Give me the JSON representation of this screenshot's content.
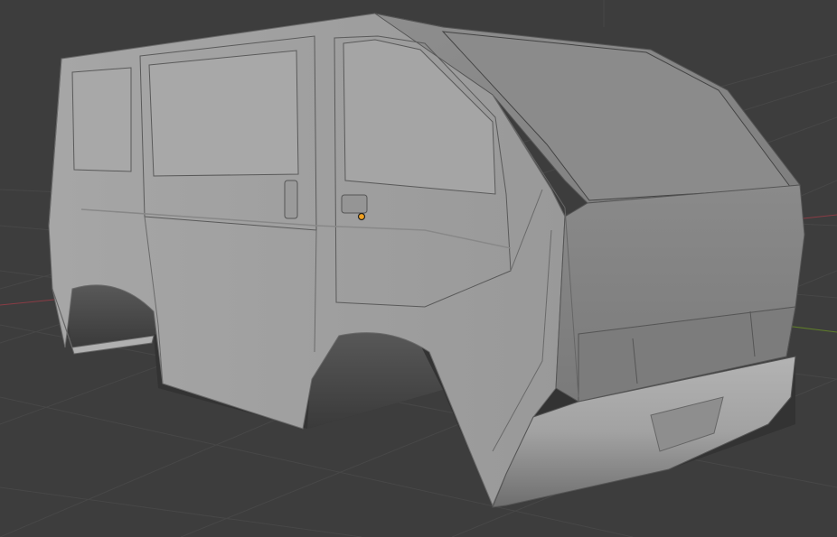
{
  "viewport": {
    "background_color": "#3d3d3d",
    "grid_color": "#474747",
    "x_axis_color": "#8a3c45",
    "y_axis_color": "#5e7c2a",
    "origin_marker_color": "#f0a020"
  },
  "scene": {
    "object": "van-body-mesh",
    "shading": "solid",
    "object_color": "#9b9b9b"
  }
}
